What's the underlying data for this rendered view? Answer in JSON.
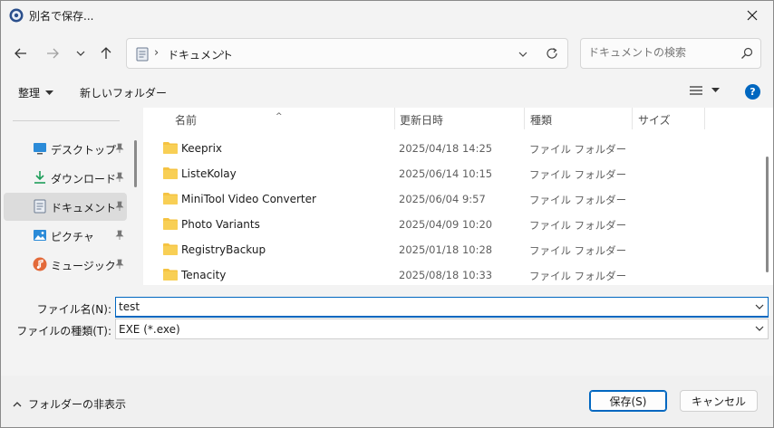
{
  "window": {
    "title": "別名で保存..."
  },
  "address": {
    "path": "ドキュメント",
    "separator": "›"
  },
  "search": {
    "placeholder": "ドキュメントの検索"
  },
  "toolbar": {
    "organize": "整理",
    "new_folder": "新しいフォルダー"
  },
  "sidebar": {
    "items": [
      {
        "label": "デスクトップ",
        "icon": "desktop-icon",
        "selected": false
      },
      {
        "label": "ダウンロード",
        "icon": "download-icon",
        "selected": false
      },
      {
        "label": "ドキュメント",
        "icon": "document-icon",
        "selected": true
      },
      {
        "label": "ピクチャ",
        "icon": "pictures-icon",
        "selected": false
      },
      {
        "label": "ミュージック",
        "icon": "music-icon",
        "selected": false
      }
    ]
  },
  "columns": {
    "name": "名前",
    "date": "更新日時",
    "type": "種類",
    "size": "サイズ"
  },
  "files": [
    {
      "name": "Keeprix",
      "date": "2025/04/18 14:25",
      "type": "ファイル フォルダー"
    },
    {
      "name": "ListeKolay",
      "date": "2025/06/14 10:15",
      "type": "ファイル フォルダー"
    },
    {
      "name": "MiniTool Video Converter",
      "date": "2025/06/04 9:57",
      "type": "ファイル フォルダー"
    },
    {
      "name": "Photo Variants",
      "date": "2025/04/09 10:20",
      "type": "ファイル フォルダー"
    },
    {
      "name": "RegistryBackup",
      "date": "2025/01/18 10:28",
      "type": "ファイル フォルダー"
    },
    {
      "name": "Tenacity",
      "date": "2025/08/18 10:33",
      "type": "ファイル フォルダー"
    }
  ],
  "form": {
    "filename_label": "ファイル名(N):",
    "filename_value": "test",
    "filetype_label": "ファイルの種類(T):",
    "filetype_value": "EXE (*.exe)"
  },
  "footer": {
    "hide_folders": "フォルダーの非表示",
    "save": "保存(S)",
    "cancel": "キャンセル"
  },
  "colors": {
    "accent": "#0067c0",
    "folder": "#f5c342"
  }
}
